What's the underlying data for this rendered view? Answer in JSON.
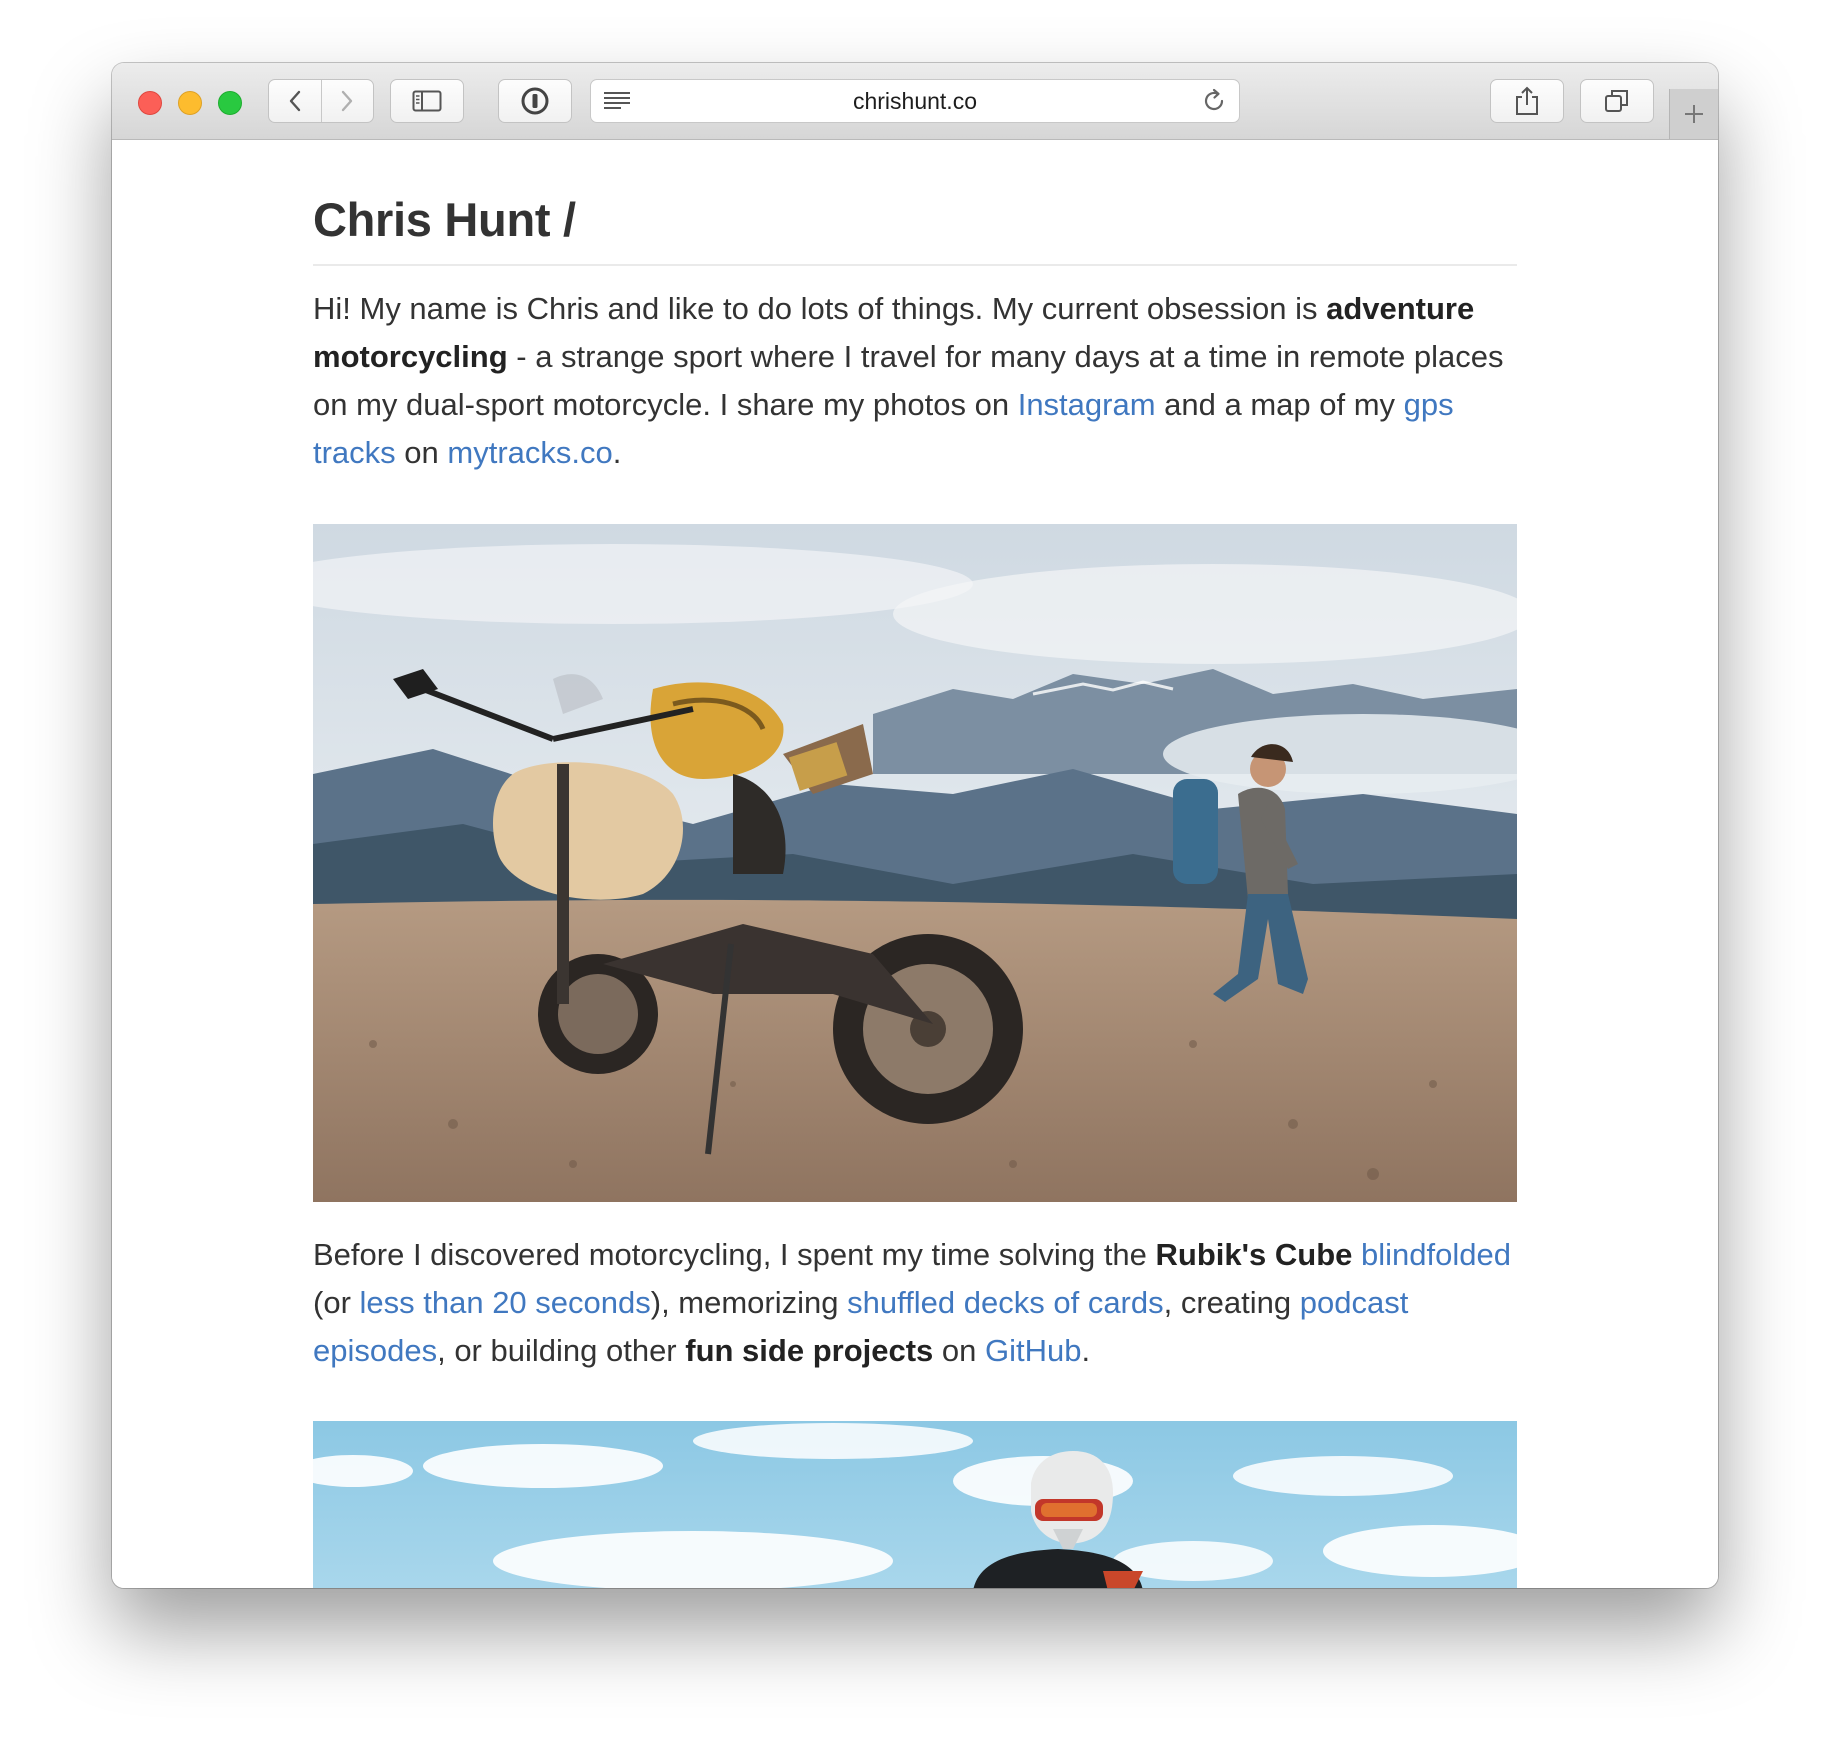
{
  "browser": {
    "url": "chrishunt.co"
  },
  "page": {
    "title": "Chris Hunt /",
    "intro": {
      "t1": "Hi! My name is Chris and like to do lots of things. My current obsession is ",
      "bold1": "adventure motorcycling",
      "t2": " - a strange sport where I travel for many days at a time in remote places on my dual-sport motorcycle. I share my photos on ",
      "link_instagram": "Instagram",
      "t3": " and a map of my ",
      "link_gps": "gps tracks",
      "t4": " on ",
      "link_mytracks": "mytracks.co",
      "t5": "."
    },
    "second": {
      "t1": "Before I discovered motorcycling, I spent my time solving the ",
      "bold1": "Rubik's Cube",
      "t2": " ",
      "link_blindfolded": "blindfolded",
      "t3": " (or ",
      "link_20sec": "less than 20 seconds",
      "t4": "), memorizing ",
      "link_cards": "shuffled decks of cards",
      "t5": ", creating ",
      "link_podcast": "podcast episodes",
      "t6": ", or building other ",
      "bold2": "fun side projects",
      "t7": " on ",
      "link_github": "GitHub",
      "t8": "."
    }
  }
}
